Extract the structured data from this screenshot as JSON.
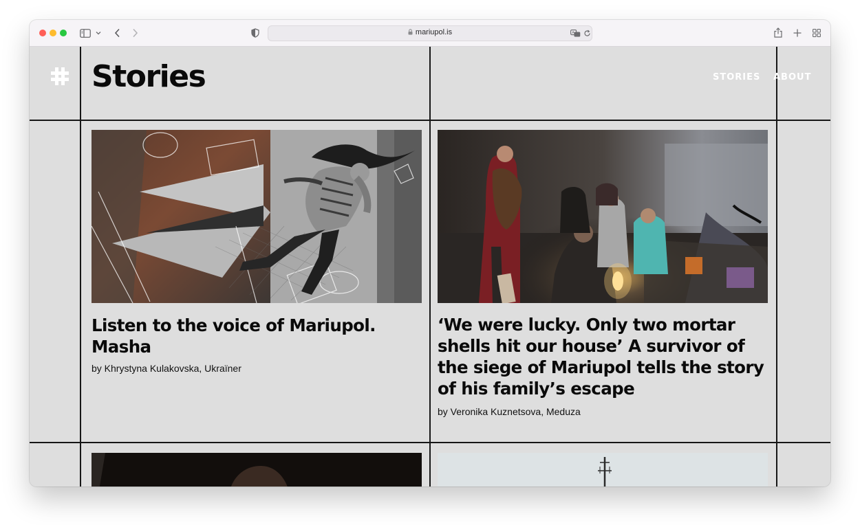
{
  "browser": {
    "url": "mariupol.is",
    "traffic_lights": [
      "#ff5f57",
      "#febc2e",
      "#28c840"
    ],
    "icons": [
      "sidebar-icon",
      "chevron-down-icon",
      "back-icon",
      "forward-icon",
      "shield-icon",
      "lock-icon",
      "translate-icon",
      "reload-icon",
      "share-icon",
      "new-tab-icon",
      "tab-overview-icon"
    ]
  },
  "site": {
    "logo_icon": "hash-icon",
    "page_title": "Stories",
    "nav": [
      {
        "label": "STORIES"
      },
      {
        "label": "ABOUT"
      }
    ]
  },
  "stories": [
    {
      "title": "Listen to the voice of Mariupol. Masha",
      "byline": "by Khrystyna Kulakovska, Ukraïner"
    },
    {
      "title": "‘We were lucky. Only two mortar shells hit our house’ A survivor of the siege of Mariupol tells the story of his family’s escape",
      "byline": "by Veronika Kuznetsova, Meduza"
    }
  ],
  "colors": {
    "page_background": "#dedede",
    "grid_lines": "#161616",
    "nav_text": "#ffffff",
    "title_text": "#0a0a0a"
  }
}
